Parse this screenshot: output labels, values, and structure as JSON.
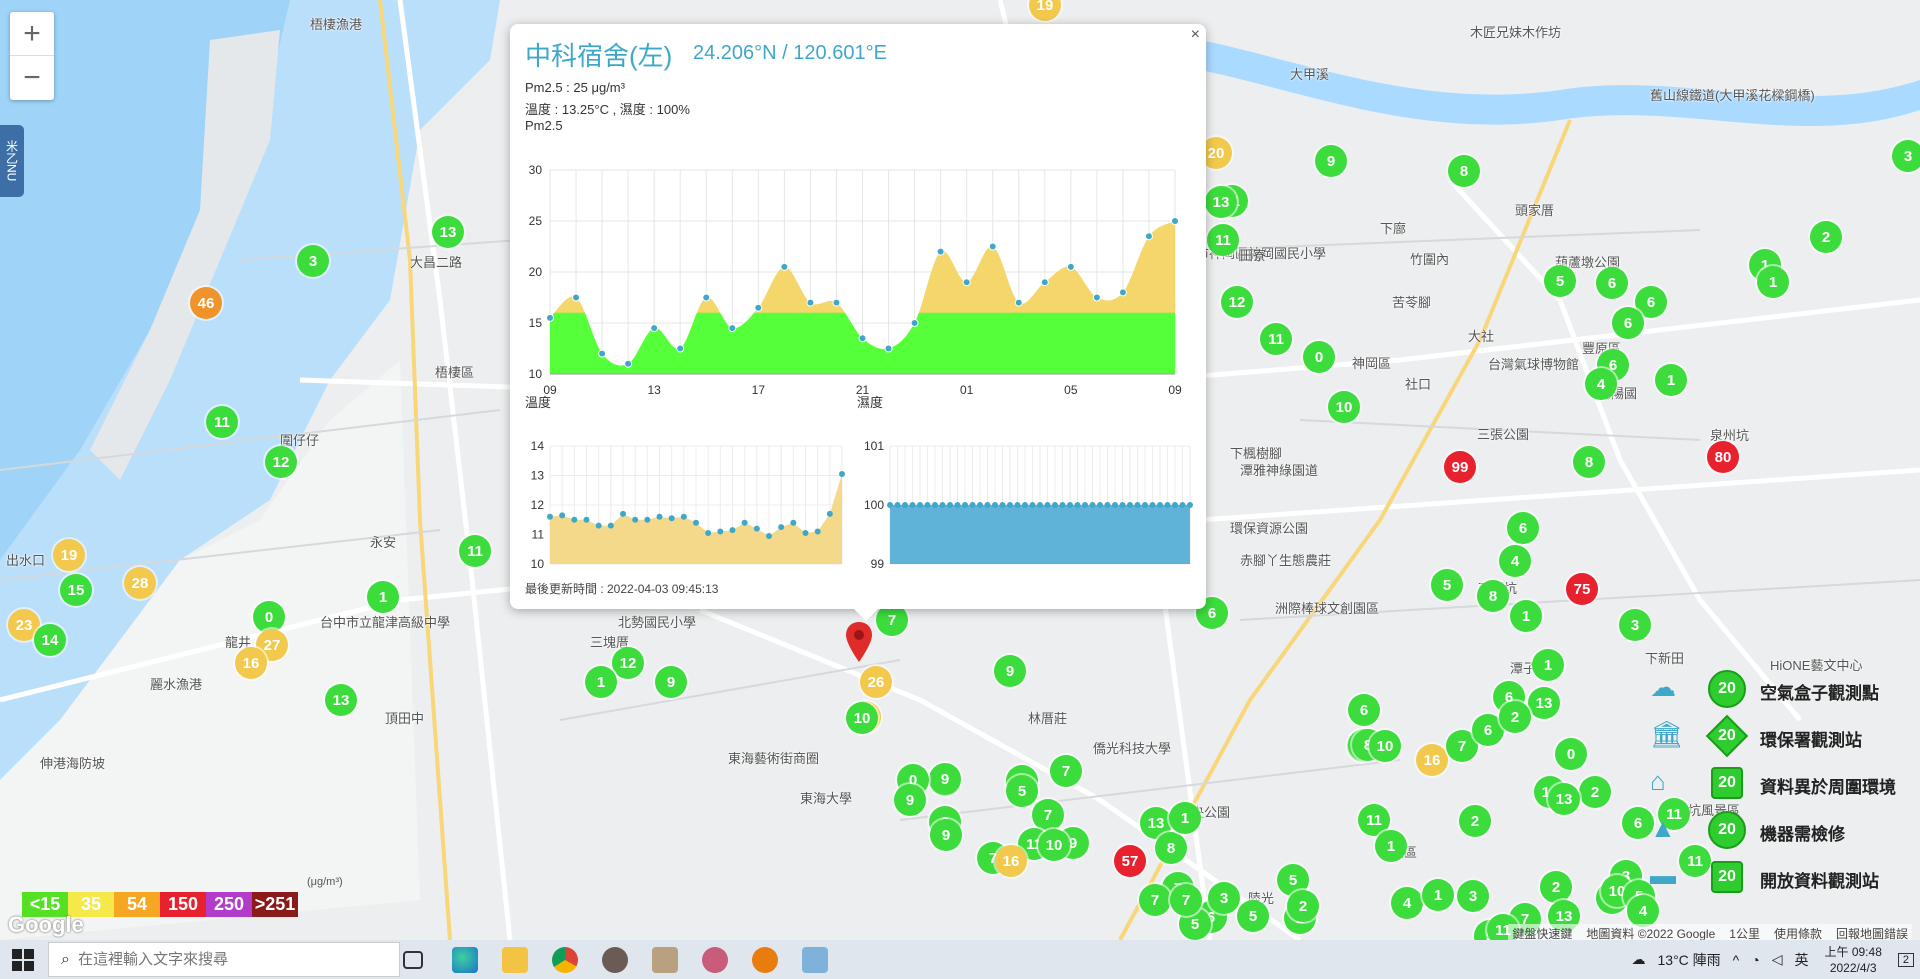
{
  "map": {
    "places": [
      {
        "label": "梧棲漁港"
      },
      {
        "label": "大甲溪"
      },
      {
        "label": "木匠兄妹木作坊"
      },
      {
        "label": "舊山線鐵道(大甲溪花樑鋼橋)"
      },
      {
        "label": "梧棲區"
      },
      {
        "label": "下廍"
      },
      {
        "label": "竹圍內"
      },
      {
        "label": "臺中市神岡區神岡國民小學"
      },
      {
        "label": "苦苓腳"
      },
      {
        "label": "神岡區"
      },
      {
        "label": "社口"
      },
      {
        "label": "台灣氣球博物館"
      },
      {
        "label": "豐原區"
      },
      {
        "label": "南陽國"
      },
      {
        "label": "大社"
      },
      {
        "label": "葫蘆墩公園"
      },
      {
        "label": "三張公園"
      },
      {
        "label": "泉州坑"
      },
      {
        "label": "圍仔仔"
      },
      {
        "label": "永安"
      },
      {
        "label": "龍井"
      },
      {
        "label": "麗水漁港"
      },
      {
        "label": "頂田中"
      },
      {
        "label": "伸港海防坡"
      },
      {
        "label": "三塊厝"
      },
      {
        "label": "北勢國民小學"
      },
      {
        "label": "東海藝術街商圈"
      },
      {
        "label": "東海大學"
      },
      {
        "label": "林厝莊"
      },
      {
        "label": "僑光科技大學"
      },
      {
        "label": "中央公園"
      },
      {
        "label": "潭雅神綠園道"
      },
      {
        "label": "赤腳丫生態農莊"
      },
      {
        "label": "洲際棒球文創園區"
      },
      {
        "label": "石頭坑"
      },
      {
        "label": "下新田"
      },
      {
        "label": "陸光"
      },
      {
        "label": "北屯區"
      },
      {
        "label": "台中市立龍津高級中學"
      },
      {
        "label": "出水口"
      },
      {
        "label": "環保資源公園"
      },
      {
        "label": "大坑風景區"
      },
      {
        "label": "下楓樹腳"
      },
      {
        "label": "頭家厝"
      },
      {
        "label": "潭子"
      },
      {
        "label": "田心"
      },
      {
        "label": "大昌二路"
      },
      {
        "label": "田寮"
      },
      {
        "label": "HiONE藝文中心"
      }
    ],
    "markers": [
      {
        "value": "19",
        "color": "#f2c94c"
      },
      {
        "value": "3",
        "color": "#3ddc3d"
      },
      {
        "value": "20",
        "color": "#f2c94c"
      },
      {
        "value": "9",
        "color": "#3ddc3d"
      },
      {
        "value": "8",
        "color": "#3ddc3d"
      },
      {
        "value": "13",
        "color": "#3ddc3d"
      },
      {
        "value": "11",
        "color": "#3ddc3d"
      },
      {
        "value": "12",
        "color": "#3ddc3d"
      },
      {
        "value": "2",
        "color": "#3ddc3d"
      },
      {
        "value": "1",
        "color": "#3ddc3d"
      },
      {
        "value": "1",
        "color": "#3ddc3d"
      },
      {
        "value": "11",
        "color": "#3ddc3d"
      },
      {
        "value": "5",
        "color": "#3ddc3d"
      },
      {
        "value": "6",
        "color": "#3ddc3d"
      },
      {
        "value": "6",
        "color": "#3ddc3d"
      },
      {
        "value": "6",
        "color": "#3ddc3d"
      },
      {
        "value": "6",
        "color": "#3ddc3d"
      },
      {
        "value": "4",
        "color": "#3ddc3d"
      },
      {
        "value": "1",
        "color": "#3ddc3d"
      },
      {
        "value": "0",
        "color": "#3ddc3d"
      },
      {
        "value": "10",
        "color": "#3ddc3d"
      },
      {
        "value": "11",
        "color": "#3ddc3d"
      },
      {
        "value": "13",
        "color": "#3ddc3d"
      },
      {
        "value": "3",
        "color": "#3ddc3d"
      },
      {
        "value": "46",
        "color": "#f0932b"
      },
      {
        "value": "11",
        "color": "#3ddc3d"
      },
      {
        "value": "12",
        "color": "#3ddc3d"
      },
      {
        "value": "99",
        "color": "#e8212e"
      },
      {
        "value": "80",
        "color": "#e8212e"
      },
      {
        "value": "8",
        "color": "#3ddc3d"
      },
      {
        "value": "6",
        "color": "#3ddc3d"
      },
      {
        "value": "19",
        "color": "#f2c94c"
      },
      {
        "value": "15",
        "color": "#3ddc3d"
      },
      {
        "value": "28",
        "color": "#f2c94c"
      },
      {
        "value": "11",
        "color": "#3ddc3d"
      },
      {
        "value": "1",
        "color": "#3ddc3d"
      },
      {
        "value": "0",
        "color": "#3ddc3d"
      },
      {
        "value": "27",
        "color": "#f2c94c"
      },
      {
        "value": "16",
        "color": "#f2c94c"
      },
      {
        "value": "23",
        "color": "#f2c94c"
      },
      {
        "value": "14",
        "color": "#3ddc3d"
      },
      {
        "value": "13",
        "color": "#3ddc3d"
      },
      {
        "value": "12",
        "color": "#3ddc3d"
      },
      {
        "value": "1",
        "color": "#3ddc3d"
      },
      {
        "value": "9",
        "color": "#3ddc3d"
      },
      {
        "value": "7",
        "color": "#3ddc3d"
      },
      {
        "value": "26",
        "color": "#f2c94c"
      },
      {
        "value": "20",
        "color": "#f2c94c"
      },
      {
        "value": "10",
        "color": "#3ddc3d"
      },
      {
        "value": "9",
        "color": "#3ddc3d"
      },
      {
        "value": "6",
        "color": "#3ddc3d"
      },
      {
        "value": "5",
        "color": "#3ddc3d"
      },
      {
        "value": "8",
        "color": "#3ddc3d"
      },
      {
        "value": "4",
        "color": "#3ddc3d"
      },
      {
        "value": "75",
        "color": "#e8212e"
      },
      {
        "value": "1",
        "color": "#3ddc3d"
      },
      {
        "value": "3",
        "color": "#3ddc3d"
      },
      {
        "value": "1",
        "color": "#3ddc3d"
      },
      {
        "value": "6",
        "color": "#3ddc3d"
      },
      {
        "value": "13",
        "color": "#3ddc3d"
      },
      {
        "value": "10",
        "color": "#3ddc3d"
      },
      {
        "value": "16",
        "color": "#f2c94c"
      },
      {
        "value": "7",
        "color": "#3ddc3d"
      },
      {
        "value": "11",
        "color": "#3ddc3d"
      },
      {
        "value": "3",
        "color": "#3ddc3d"
      },
      {
        "value": "6",
        "color": "#3ddc3d"
      },
      {
        "value": "8",
        "color": "#3ddc3d"
      },
      {
        "value": "10",
        "color": "#3ddc3d"
      },
      {
        "value": "12",
        "color": "#3ddc3d"
      },
      {
        "value": "9",
        "color": "#3ddc3d"
      },
      {
        "value": "0",
        "color": "#3ddc3d"
      },
      {
        "value": "9",
        "color": "#3ddc3d"
      },
      {
        "value": "0",
        "color": "#3ddc3d"
      },
      {
        "value": "9",
        "color": "#3ddc3d"
      },
      {
        "value": "4",
        "color": "#3ddc3d"
      },
      {
        "value": "5",
        "color": "#3ddc3d"
      },
      {
        "value": "7",
        "color": "#3ddc3d"
      },
      {
        "value": "7",
        "color": "#3ddc3d"
      },
      {
        "value": "11",
        "color": "#3ddc3d"
      },
      {
        "value": "9",
        "color": "#3ddc3d"
      },
      {
        "value": "10",
        "color": "#3ddc3d"
      },
      {
        "value": "7",
        "color": "#3ddc3d"
      },
      {
        "value": "16",
        "color": "#f2c94c"
      },
      {
        "value": "13",
        "color": "#3ddc3d"
      },
      {
        "value": "57",
        "color": "#e8212e"
      },
      {
        "value": "8",
        "color": "#3ddc3d"
      },
      {
        "value": "7",
        "color": "#3ddc3d"
      },
      {
        "value": "2",
        "color": "#3ddc3d"
      },
      {
        "value": "7",
        "color": "#3ddc3d"
      },
      {
        "value": "6",
        "color": "#3ddc3d"
      },
      {
        "value": "5",
        "color": "#3ddc3d"
      },
      {
        "value": "1",
        "color": "#3ddc3d"
      },
      {
        "value": "5",
        "color": "#3ddc3d"
      },
      {
        "value": "7",
        "color": "#3ddc3d"
      },
      {
        "value": "5",
        "color": "#3ddc3d"
      },
      {
        "value": "2",
        "color": "#3ddc3d"
      },
      {
        "value": "2",
        "color": "#3ddc3d"
      },
      {
        "value": "3",
        "color": "#3ddc3d"
      },
      {
        "value": "11",
        "color": "#3ddc3d"
      },
      {
        "value": "1",
        "color": "#3ddc3d"
      },
      {
        "value": "4",
        "color": "#3ddc3d"
      },
      {
        "value": "1",
        "color": "#3ddc3d"
      },
      {
        "value": "3",
        "color": "#3ddc3d"
      },
      {
        "value": "2",
        "color": "#3ddc3d"
      },
      {
        "value": "6",
        "color": "#3ddc3d"
      },
      {
        "value": "2",
        "color": "#3ddc3d"
      },
      {
        "value": "2",
        "color": "#3ddc3d"
      },
      {
        "value": "0",
        "color": "#3ddc3d"
      },
      {
        "value": "2",
        "color": "#3ddc3d"
      },
      {
        "value": "7",
        "color": "#3ddc3d"
      },
      {
        "value": "5",
        "color": "#3ddc3d"
      },
      {
        "value": "11",
        "color": "#3ddc3d"
      },
      {
        "value": "3",
        "color": "#3ddc3d"
      },
      {
        "value": "1",
        "color": "#3ddc3d"
      },
      {
        "value": "13",
        "color": "#3ddc3d"
      },
      {
        "value": "10",
        "color": "#3ddc3d"
      },
      {
        "value": "5",
        "color": "#3ddc3d"
      },
      {
        "value": "11",
        "color": "#3ddc3d"
      },
      {
        "value": "11",
        "color": "#3ddc3d"
      },
      {
        "value": "6",
        "color": "#3ddc3d"
      },
      {
        "value": "4",
        "color": "#3ddc3d"
      },
      {
        "value": "13",
        "color": "#3ddc3d"
      }
    ]
  },
  "zoom": {
    "in": "+",
    "out": "−"
  },
  "side_tab": {
    "label": "米乙NU"
  },
  "popup": {
    "title": "中科宿舍(左)",
    "coord": "24.206°N / 120.601°E",
    "pm_line": "Pm2.5 : 25 μg/m³",
    "weather_line": "溫度 : 13.25°C , 濕度 : 100%",
    "pm_label": "Pm2.5",
    "temp_label": "溫度",
    "hum_label": "濕度",
    "updated": "最後更新時間 : 2022-04-03 09:45:13",
    "close": "×"
  },
  "chart_data": [
    {
      "type": "area",
      "title": "Pm2.5",
      "x_ticks": [
        "09",
        "13",
        "17",
        "21",
        "01",
        "05",
        "09"
      ],
      "ylim": [
        10,
        30
      ],
      "y_ticks": [
        10,
        15,
        20,
        25,
        30
      ],
      "green_threshold": 16,
      "colors": {
        "fill_low": "#55ff3a",
        "fill_high": "#f4d66b",
        "point": "#3fa8c9"
      },
      "values": [
        15.5,
        17.5,
        12,
        11,
        14.5,
        12.5,
        17.5,
        14.5,
        16.5,
        20.5,
        17,
        17,
        13.5,
        12.5,
        15,
        22,
        19,
        22.5,
        17,
        19,
        20.5,
        17.5,
        18,
        23.5,
        25
      ]
    },
    {
      "type": "area",
      "title": "溫度",
      "ylim": [
        10,
        14
      ],
      "y_ticks": [
        10,
        11,
        12,
        13,
        14
      ],
      "colors": {
        "fill": "#f4d98a",
        "point": "#3fa8c9"
      },
      "values": [
        11.6,
        11.65,
        11.5,
        11.5,
        11.3,
        11.3,
        11.7,
        11.5,
        11.5,
        11.6,
        11.55,
        11.6,
        11.4,
        11.05,
        11.1,
        11.15,
        11.4,
        11.2,
        10.95,
        11.25,
        11.4,
        11.05,
        11.1,
        11.7,
        13.05
      ]
    },
    {
      "type": "area",
      "title": "濕度",
      "ylim": [
        99,
        101
      ],
      "y_ticks": [
        99,
        100,
        101
      ],
      "colors": {
        "fill": "#5fb3d9",
        "point": "#3fa8c9"
      },
      "values": [
        100,
        100,
        100,
        100,
        100,
        100,
        100,
        100,
        100,
        100,
        100,
        100,
        100,
        100,
        100,
        100,
        100,
        100,
        100,
        100,
        100,
        100,
        100,
        100,
        100,
        100,
        100,
        100,
        100,
        100,
        100,
        100,
        100,
        100,
        100,
        100,
        100,
        100,
        100,
        100,
        100
      ]
    }
  ],
  "aqi_legend": {
    "unit": "(μg/m³)",
    "levels": [
      {
        "label": "<15",
        "color": "#55e024"
      },
      {
        "label": "35",
        "color": "#f5e94a"
      },
      {
        "label": "54",
        "color": "#f5a623"
      },
      {
        "label": "150",
        "color": "#e8212e"
      },
      {
        "label": "250",
        "color": "#b23cc9"
      },
      {
        "label": ">251",
        "color": "#8b1a1a"
      }
    ]
  },
  "type_legend": [
    {
      "label": "空氣盒子觀測點",
      "value": "20",
      "icon": "cloud-icon"
    },
    {
      "label": "環保署觀測站",
      "value": "20",
      "icon": "government-building-icon"
    },
    {
      "label": "資料異於周圍環境",
      "value": "20",
      "icon": "house-icon"
    },
    {
      "label": "機器需檢修",
      "value": "20",
      "icon": "traffic-cone-icon"
    },
    {
      "label": "開放資料觀測站",
      "value": "20",
      "icon": "tray-icon"
    }
  ],
  "google": {
    "logo": "Google"
  },
  "attribution": {
    "shortcuts": "鍵盤快速鍵",
    "map_data": "地圖資料 ©2022 Google",
    "scale": "1公里",
    "terms": "使用條款",
    "report": "回報地圖錯誤"
  },
  "taskbar": {
    "search_placeholder": "在這裡輸入文字來搜尋",
    "weather": "13°C 陣雨",
    "ime": "英",
    "time": "上午 09:48",
    "date": "2022/4/3",
    "notifications": "2"
  }
}
